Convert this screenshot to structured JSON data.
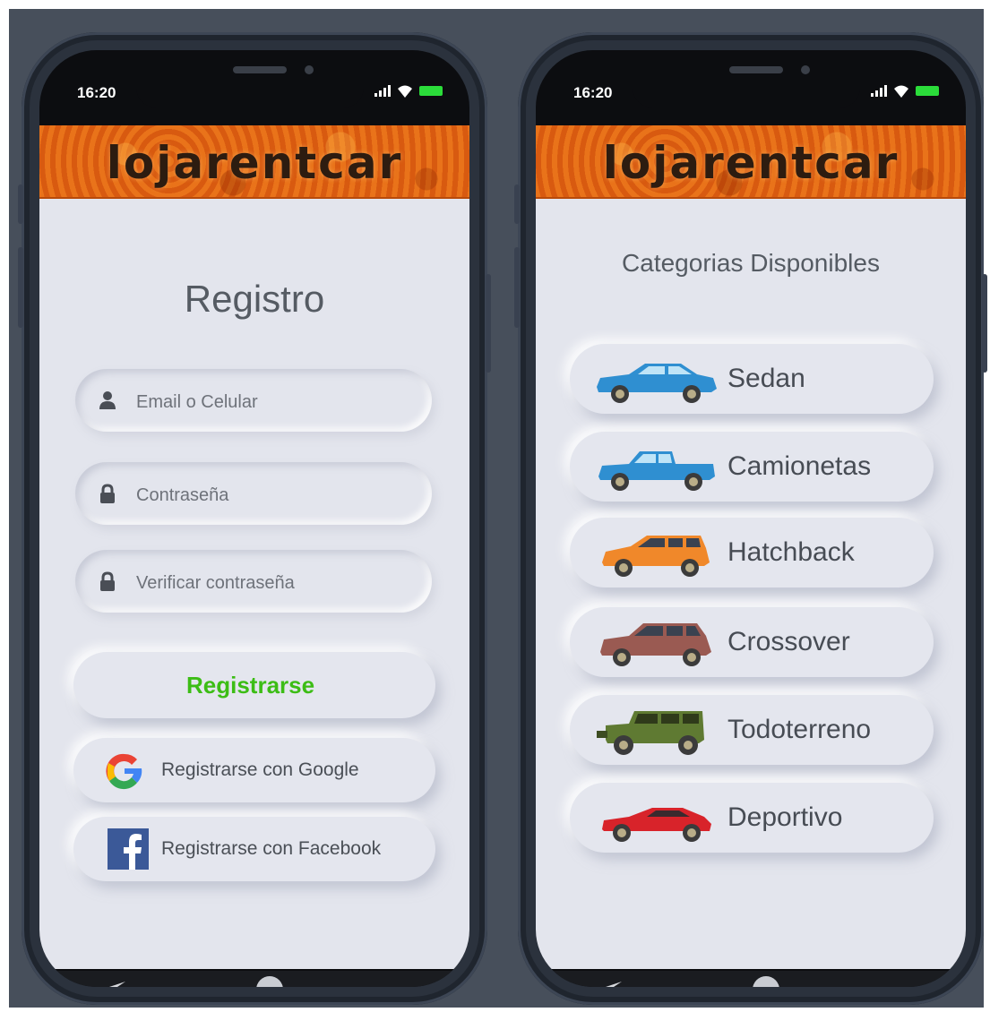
{
  "status": {
    "time": "16:20"
  },
  "brand": "lojarentcar",
  "register": {
    "title": "Registro",
    "email_placeholder": "Email o Celular",
    "password_placeholder": "Contraseña",
    "verify_placeholder": "Verificar contraseña",
    "submit_label": "Registrarse",
    "google_label": "Registrarse con Google",
    "facebook_label": "Registrarse con Facebook"
  },
  "categories": {
    "title": "Categorias Disponibles",
    "items": [
      {
        "label": "Sedan",
        "color": "#2f8fd1",
        "icon": "sedan-car-icon"
      },
      {
        "label": "Camionetas",
        "color": "#2f8fd1",
        "icon": "pickup-truck-icon"
      },
      {
        "label": "Hatchback",
        "color": "#f0882a",
        "icon": "hatchback-car-icon"
      },
      {
        "label": "Crossover",
        "color": "#9a5a52",
        "icon": "crossover-car-icon"
      },
      {
        "label": "Todoterreno",
        "color": "#5f7a32",
        "icon": "offroad-car-icon"
      },
      {
        "label": "Deportivo",
        "color": "#d8232a",
        "icon": "sports-car-icon"
      }
    ]
  },
  "colors": {
    "accent_green": "#3cbd15",
    "header_orange": "#e9731a",
    "background": "#e3e5ed"
  }
}
